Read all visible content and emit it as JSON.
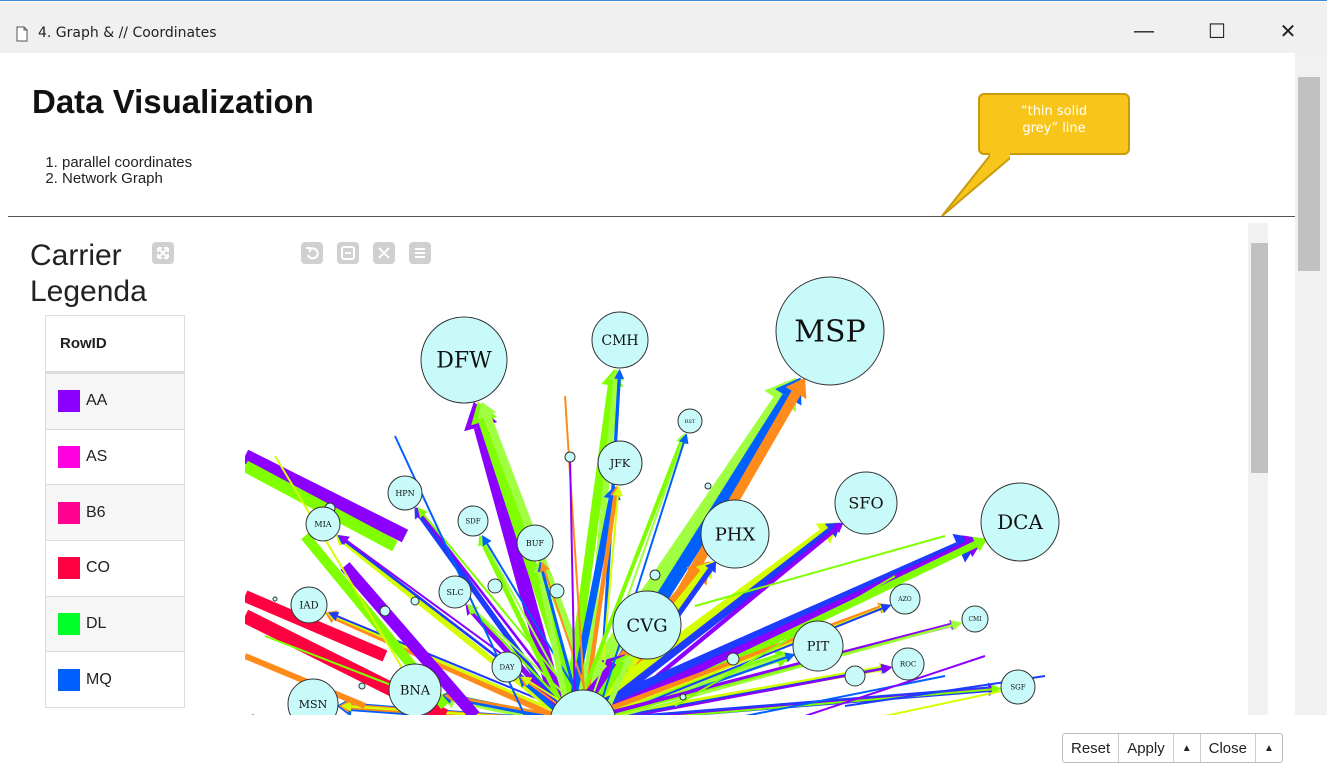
{
  "window": {
    "title": "4. Graph & // Coordinates",
    "minimize_glyph": "—",
    "maximize_glyph": "☐",
    "close_glyph": "✕"
  },
  "page": {
    "heading": "Data Visualization",
    "list": [
      "parallel coordinates",
      "Network Graph"
    ]
  },
  "callout": {
    "line1": "“thin solid",
    "line2": "grey” line",
    "color": "#f8c51a"
  },
  "legend": {
    "title_line1": "Carrier",
    "title_line2": "Legenda",
    "header": "RowID",
    "items": [
      {
        "code": "AA",
        "color": "#8b00ff"
      },
      {
        "code": "AS",
        "color": "#ff00e0"
      },
      {
        "code": "B6",
        "color": "#ff0090"
      },
      {
        "code": "CO",
        "color": "#ff0040"
      },
      {
        "code": "DL",
        "color": "#00ff2a"
      },
      {
        "code": "MQ",
        "color": "#0060ff"
      }
    ]
  },
  "graph_nodes": [
    {
      "label": "DFW"
    },
    {
      "label": "CMH"
    },
    {
      "label": "MSP"
    },
    {
      "label": "JFK"
    },
    {
      "label": "PHX"
    },
    {
      "label": "SFO"
    },
    {
      "label": "DCA"
    },
    {
      "label": "CVG"
    },
    {
      "label": "PIT"
    },
    {
      "label": "BNA"
    },
    {
      "label": "MSN"
    },
    {
      "label": "IAD"
    },
    {
      "label": "MIA"
    },
    {
      "label": "HPN"
    },
    {
      "label": "SLC"
    },
    {
      "label": "SDF"
    },
    {
      "label": "BUF"
    },
    {
      "label": "DAY"
    },
    {
      "label": "AZO"
    },
    {
      "label": "ROC"
    },
    {
      "label": "SGF"
    },
    {
      "label": "CMI"
    },
    {
      "label": "RST"
    }
  ],
  "footer": {
    "reset": "Reset",
    "apply": "Apply",
    "apply_arrow": "▲",
    "close": "Close",
    "close_arrow": "▲"
  }
}
